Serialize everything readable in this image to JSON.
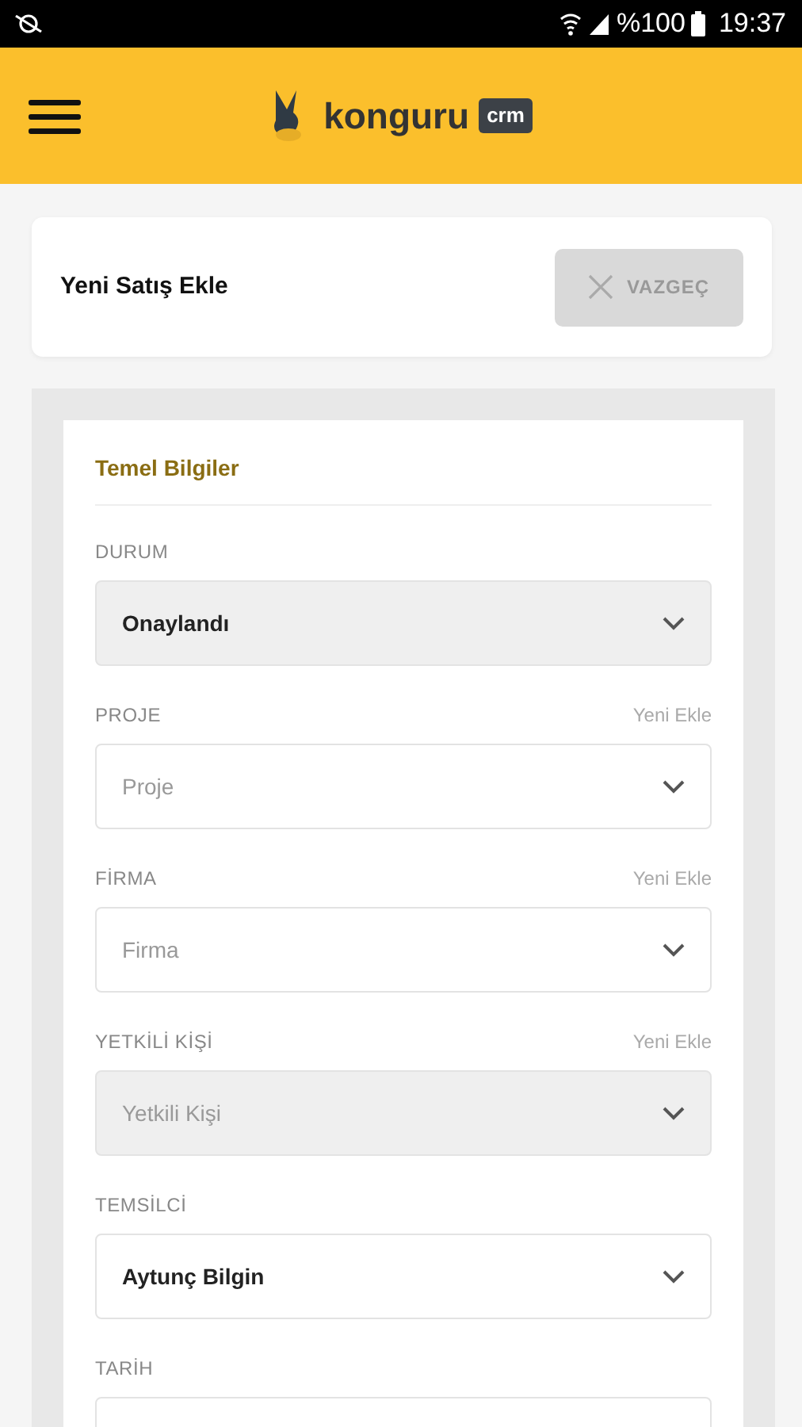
{
  "status_bar": {
    "battery": "%100",
    "time": "19:37"
  },
  "header": {
    "logo_text": "konguru",
    "logo_badge": "crm"
  },
  "page_header": {
    "title": "Yeni Satış Ekle",
    "cancel_button": "VAZGEÇ"
  },
  "section": {
    "title": "Temel Bilgiler",
    "fields": [
      {
        "label": "DURUM",
        "value": "Onaylandı",
        "disabled": true
      },
      {
        "label": "PROJE",
        "action": "Yeni Ekle",
        "placeholder": "Proje",
        "disabled": false
      },
      {
        "label": "FİRMA",
        "action": "Yeni Ekle",
        "placeholder": "Firma",
        "disabled": false
      },
      {
        "label": "YETKİLİ KİŞİ",
        "action": "Yeni Ekle",
        "placeholder": "Yetkili Kişi",
        "disabled": true
      },
      {
        "label": "TEMSİLCİ",
        "value": "Aytunç Bilgin",
        "disabled": false
      },
      {
        "label": "TARİH"
      }
    ]
  }
}
